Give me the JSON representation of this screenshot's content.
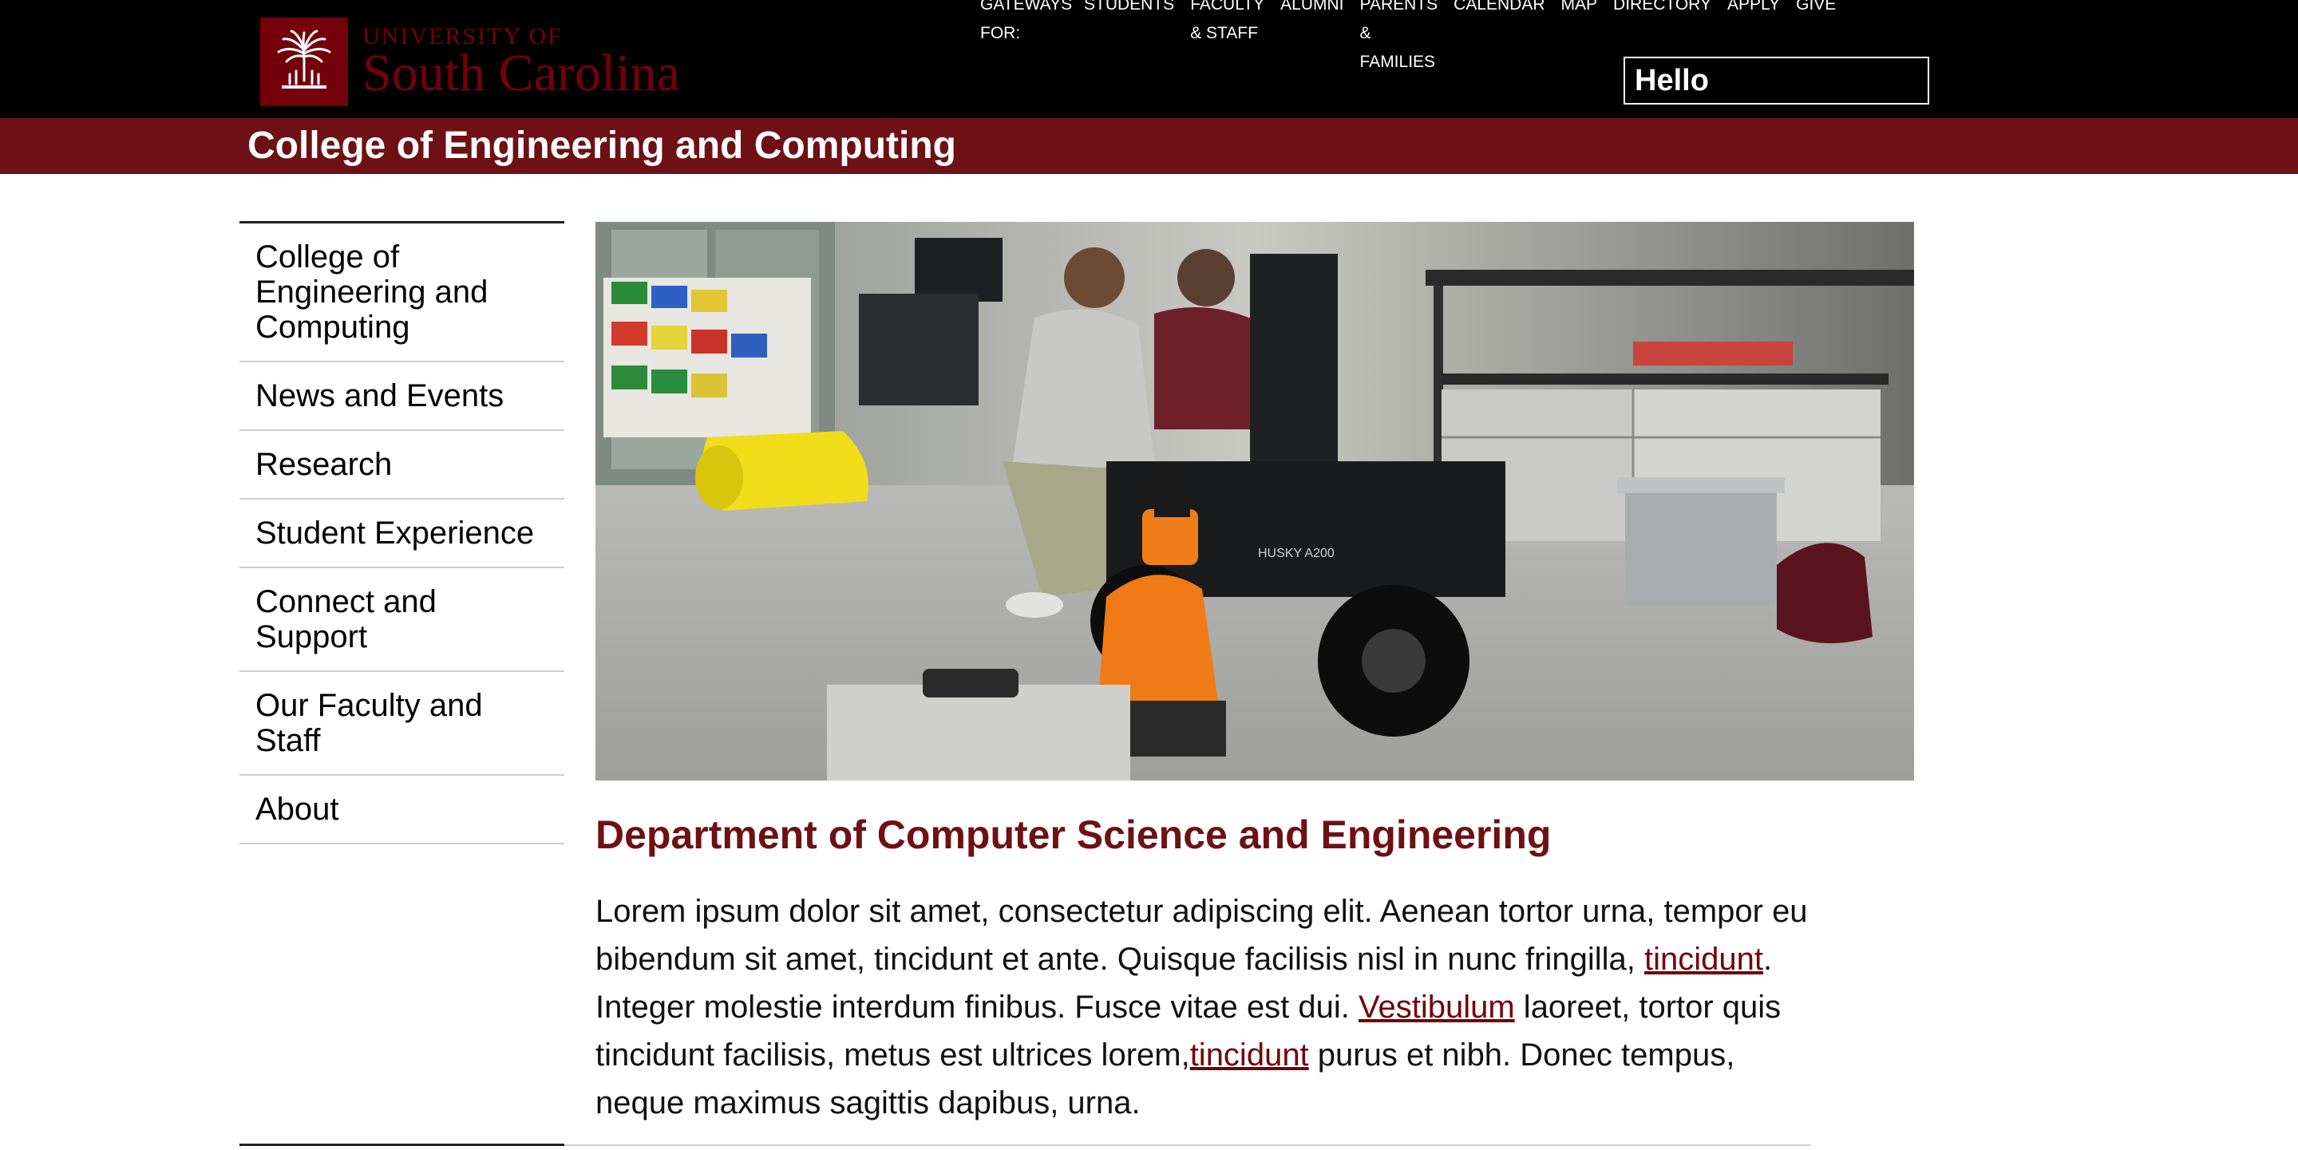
{
  "brand": {
    "university_line": "UNIVERSITY OF",
    "name_line": "South Carolina",
    "color": "#73000a"
  },
  "gateways": {
    "label_lines": [
      "GATEWAYS",
      "FOR:"
    ],
    "items": [
      {
        "lines": [
          "STUDENTS"
        ]
      },
      {
        "lines": [
          "FACULTY",
          "& STAFF"
        ]
      },
      {
        "lines": [
          "ALUMNI"
        ]
      },
      {
        "lines": [
          "PARENTS",
          "&",
          "FAMILIES"
        ]
      },
      {
        "lines": [
          "CALENDAR"
        ]
      },
      {
        "lines": [
          "MAP"
        ]
      },
      {
        "lines": [
          "DIRECTORY"
        ]
      },
      {
        "lines": [
          "APPLY"
        ]
      },
      {
        "lines": [
          "GIVE"
        ]
      }
    ]
  },
  "greeting_box": {
    "text": "Hello"
  },
  "banner": {
    "title": "College of Engineering and Computing",
    "color": "#6e1014"
  },
  "sidebar": {
    "items": [
      {
        "label": "College of Engineering and Computing"
      },
      {
        "label": "News and Events"
      },
      {
        "label": "Research"
      },
      {
        "label": "Student Experience"
      },
      {
        "label": "Connect and Support"
      },
      {
        "label": "Our Faculty and Staff"
      },
      {
        "label": "About"
      }
    ]
  },
  "hero": {
    "icon": "robotics-lab-photo",
    "robot_label": "HUSKY A200"
  },
  "main": {
    "title": "Department of Computer Science and Engineering",
    "paragraph": {
      "t1": "Lorem ipsum dolor sit amet, consectetur adipiscing elit. Aenean tortor urna, tempor eu bibendum sit amet, tincidunt et ante. Quisque facilisis nisl in nunc fringilla, ",
      "link1": "tincidunt",
      "t2": ". Integer molestie interdum finibus. Fusce vitae est dui. ",
      "link2": "Vestibulum",
      "t3": " laoreet, tortor quis tincidunt facilisis, metus est ultrices lorem,",
      "link3": "tincidunt",
      "t4": " purus et nibh. Donec tempus, neque maximus sagittis dapibus, urna."
    }
  }
}
